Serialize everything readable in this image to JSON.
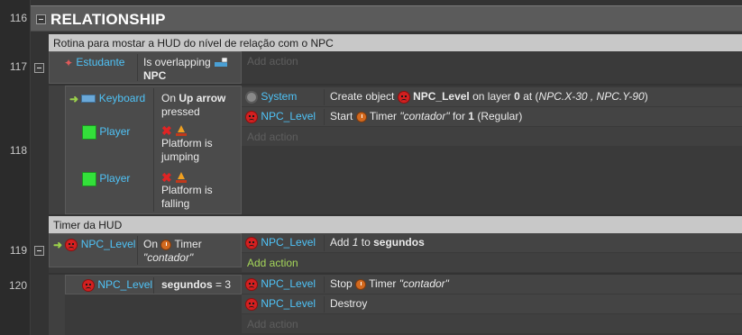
{
  "group": {
    "title": "RELATIONSHIP",
    "line": "116"
  },
  "comments": {
    "c1": "Rotina para mostar a HUD do nível de relação com o NPC",
    "c2": "Timer da HUD"
  },
  "events": {
    "e117": {
      "line": "117",
      "cond_object": "Estudante",
      "cond_text_1": "Is overlapping",
      "cond_text_2": "NPC",
      "add_action": "Add action"
    },
    "e118": {
      "line": "118",
      "c1_object": "Keyboard",
      "c1_text_1": "On",
      "c1_text_bold": "Up arrow",
      "c1_text_2": "pressed",
      "c2_object": "Player",
      "c2_text_1": "Platform is",
      "c2_text_2": "jumping",
      "c3_object": "Player",
      "c3_text_1": "Platform is",
      "c3_text_2": "falling",
      "a1_object": "System",
      "a1_pre": "Create object",
      "a1_obj": "NPC_Level",
      "a1_mid": "on layer",
      "a1_layer": "0",
      "a1_at": "at (",
      "a1_coords": "NPC.X-30 , NPC.Y-90",
      "a1_end": ")",
      "a2_object": "NPC_Level",
      "a2_pre": "Start",
      "a2_timer": "Timer",
      "a2_name": "\"contador\"",
      "a2_for": "for",
      "a2_num": "1",
      "a2_mode": "(Regular)",
      "add_action": "Add action"
    },
    "e119": {
      "line": "119",
      "cond_object": "NPC_Level",
      "cond_on": "On",
      "cond_timer": "Timer",
      "cond_name": "\"contador\"",
      "a1_object": "NPC_Level",
      "a1_pre": "Add",
      "a1_num": "1",
      "a1_to": "to",
      "a1_var": "segundos",
      "add_action": "Add action"
    },
    "e120": {
      "line": "120",
      "cond_object": "NPC_Level",
      "cond_var": "segundos",
      "cond_op": "= 3",
      "a1_object": "NPC_Level",
      "a1_pre": "Stop",
      "a1_timer": "Timer",
      "a1_name": "\"contador\"",
      "a2_object": "NPC_Level",
      "a2_text": "Destroy",
      "add_action": "Add action"
    }
  },
  "colors": {
    "background": "#333333",
    "object_name": "#4fc3f7",
    "add_action_active": "#a5d65a",
    "comment_bg": "#c8c8c8",
    "npc_icon": "#d32020",
    "player_icon": "#33e03a"
  },
  "icons": {
    "npc": "sad-face-icon",
    "timer": "timer-clock-icon",
    "player": "green-square-icon",
    "keyboard": "keyboard-icon",
    "system": "gear-icon",
    "estudante": "person-icon",
    "npc_target": "desk-icon",
    "not": "red-x-icon",
    "platform": "platform-behavior-icon",
    "sub_event": "green-arrow-icon"
  }
}
